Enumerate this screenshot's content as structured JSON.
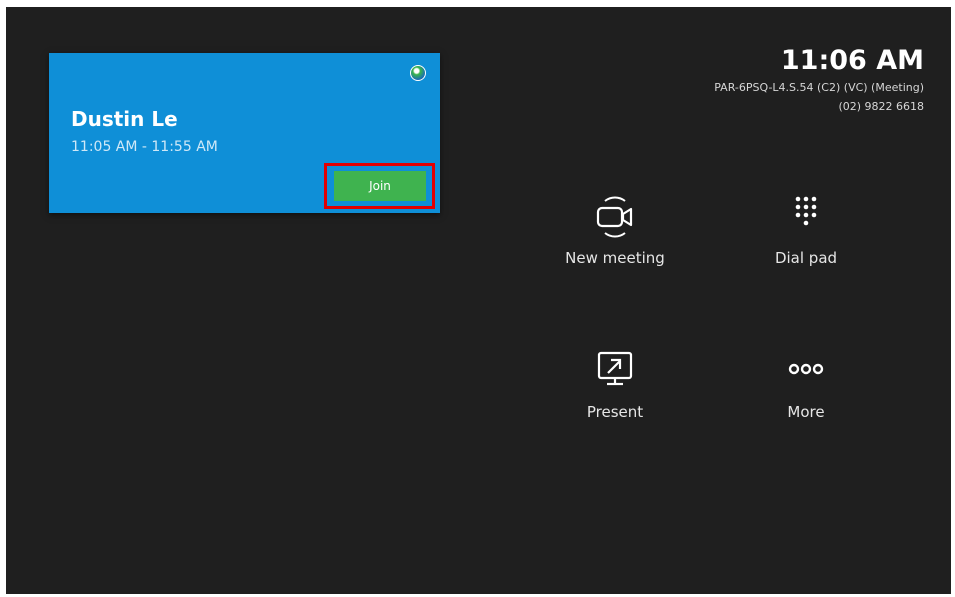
{
  "meeting": {
    "organizer": "Dustin Le",
    "time_range": "11:05 AM - 11:55 AM",
    "join_label": "Join"
  },
  "header": {
    "clock": "11:06 AM",
    "room_name": "PAR-6PSQ-L4.S.54 (C2) (VC) (Meeting)",
    "room_phone": "(02) 9822 6618"
  },
  "actions": {
    "new_meeting": {
      "label": "New meeting",
      "icon": "video-camera-icon"
    },
    "dial_pad": {
      "label": "Dial pad",
      "icon": "dial-pad-icon"
    },
    "present": {
      "label": "Present",
      "icon": "screen-share-icon"
    },
    "more": {
      "label": "More",
      "icon": "more-dots-icon"
    }
  },
  "colors": {
    "background": "#1f1f1f",
    "card": "#0f8fd7",
    "join_button": "#3fb34f",
    "highlight": "#e20000"
  }
}
